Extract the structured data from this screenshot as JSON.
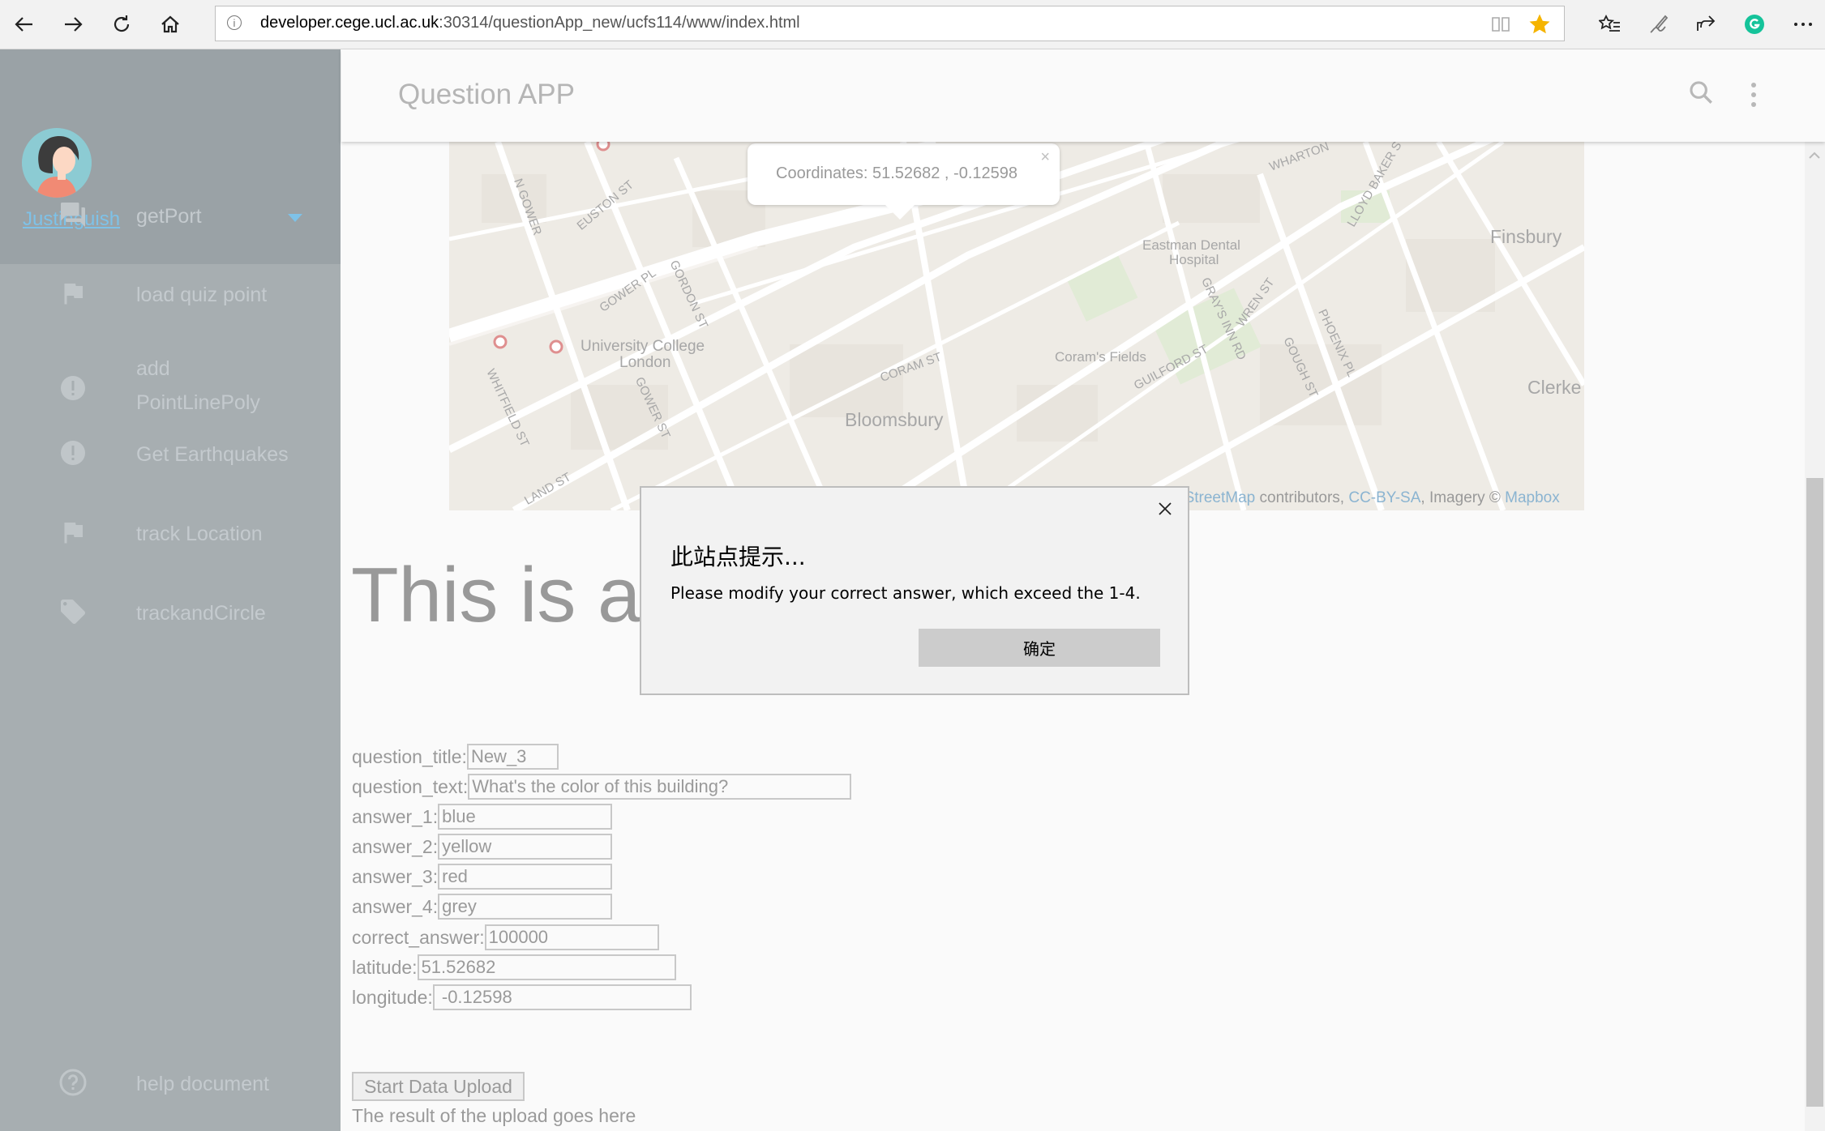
{
  "browser": {
    "url_host": "developer.cege.ucl.ac.uk",
    "url_path": ":30314/questionApp_new/ucfs114/www/index.html",
    "favorite_color": "#f5b400"
  },
  "drawer": {
    "user_name": "Justinguish",
    "menu": [
      {
        "label": "getPort",
        "icon": "forum-icon"
      },
      {
        "label": "load quiz point",
        "icon": "flag-icon"
      },
      {
        "label_line1": "add",
        "label_line2": "PointLinePoly",
        "icon": "alert-circle-icon"
      },
      {
        "label": "Get Earthquakes",
        "icon": "alert-circle-icon"
      },
      {
        "label": "track Location",
        "icon": "flag-icon"
      },
      {
        "label": "trackandCircle",
        "icon": "tag-icon"
      }
    ],
    "help_label": "help document"
  },
  "header": {
    "title": "Question APP"
  },
  "map": {
    "popup_text": "Coordinates: 51.52682 , -0.12598",
    "popup_close": "×",
    "labels": {
      "euston": "EUSTON ST",
      "gower_pl": "GOWER PL",
      "gordon": "GORDON ST",
      "ucl_line1": "University College",
      "ucl_line2": "London",
      "whitfield": "WHITFIELD ST",
      "gower_st": "GOWER ST",
      "bloomsbury": "Bloomsbury",
      "coram_st": "CORAM ST",
      "corams_fields": "Coram's Fields",
      "eastman_line1": "Eastman Dental",
      "eastman_line2": "Hospital",
      "guilford": "GUILFORD ST",
      "grays_inn": "GRAY'S INN RD",
      "wren": "WREN ST",
      "gough": "GOUGH ST",
      "phoenix": "PHOENIX PL",
      "lloyd": "LLOYD BAKER ST",
      "wharton": "WHARTON",
      "finsbury": "Finsbury",
      "clerke": "Clerke",
      "n_gower": "N GOWER",
      "land": "LAND ST"
    },
    "attribution_link1": "nStreetMap",
    "attribution_mid": " contributors, ",
    "attribution_link2": "CC-BY-SA",
    "attribution_mid2": ", Imagery © ",
    "attribution_link3": "Mapbox"
  },
  "main": {
    "heading": "This is a"
  },
  "form": {
    "question_title_label": "question_title:",
    "question_title_value": "New_3",
    "question_text_label": "question_text:",
    "question_text_value": "What's the color of this building?",
    "answer_1_label": "answer_1:",
    "answer_1_value": "blue",
    "answer_2_label": "answer_2:",
    "answer_2_value": "yellow",
    "answer_3_label": "answer_3:",
    "answer_3_value": "red",
    "answer_4_label": "answer_4:",
    "answer_4_value": "grey",
    "correct_answer_label": "correct_answer:",
    "correct_answer_value": "100000",
    "latitude_label": "latitude:",
    "latitude_value": "51.52682",
    "longitude_label": "longitude:",
    "longitude_value": " -0.12598",
    "upload_button": "Start Data Upload",
    "upload_result": "The result of the upload goes here"
  },
  "dialog": {
    "title": "此站点提示...",
    "message": "Please modify your correct answer, which exceed the 1-4.",
    "ok_label": "确定"
  }
}
